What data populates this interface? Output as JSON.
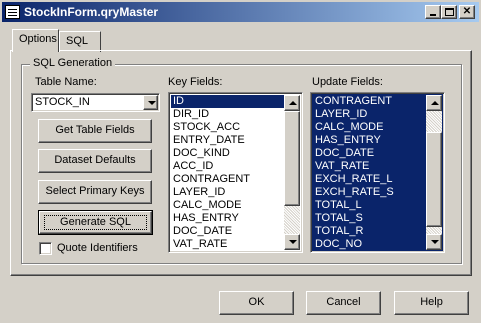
{
  "window": {
    "title": "StockInForm.qryMaster",
    "controls": [
      "minimize-icon",
      "maximize-icon",
      "close-icon"
    ]
  },
  "tabs": [
    {
      "label": "Options",
      "active": true
    },
    {
      "label": "SQL",
      "active": false
    }
  ],
  "group": {
    "title": "SQL Generation"
  },
  "table_name": {
    "label": "Table Name:",
    "value": "STOCK_IN"
  },
  "buttons": {
    "get_table_fields": "Get Table Fields",
    "dataset_defaults": "Dataset Defaults",
    "select_primary_keys": "Select Primary Keys",
    "generate_sql": "Generate SQL",
    "ok": "OK",
    "cancel": "Cancel",
    "help": "Help"
  },
  "quote_identifiers": {
    "label": "Quote Identifiers",
    "checked": false
  },
  "key_fields": {
    "label": "Key Fields:",
    "items": [
      "ID",
      "DIR_ID",
      "STOCK_ACC",
      "ENTRY_DATE",
      "DOC_KIND",
      "ACC_ID",
      "CONTRAGENT",
      "LAYER_ID",
      "CALC_MODE",
      "HAS_ENTRY",
      "DOC_DATE",
      "VAT_RATE"
    ],
    "selected": "ID"
  },
  "update_fields": {
    "label": "Update Fields:",
    "items": [
      "CONTRAGENT",
      "LAYER_ID",
      "CALC_MODE",
      "HAS_ENTRY",
      "DOC_DATE",
      "VAT_RATE",
      "EXCH_RATE_L",
      "EXCH_RATE_S",
      "TOTAL_L",
      "TOTAL_S",
      "TOTAL_R",
      "DOC_NO"
    ]
  },
  "colors": {
    "selection": "#0a246a",
    "face": "#d4d0c8",
    "title_start": "#0a246a",
    "title_end": "#a6caf0"
  }
}
